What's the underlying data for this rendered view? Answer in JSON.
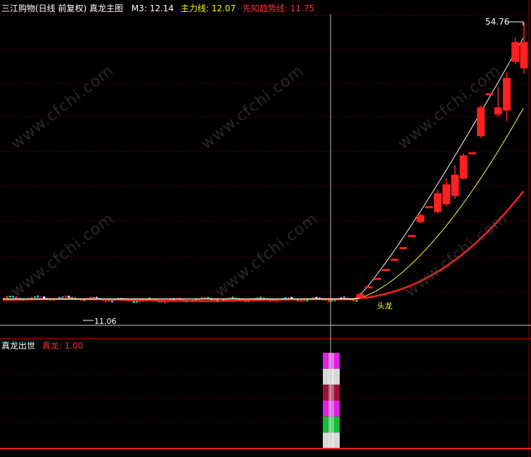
{
  "main_panel": {
    "title": "三江购物(日线 前复权) 真龙主图",
    "indicators": [
      {
        "label": "M3: ",
        "value": "12.14",
        "color": "#ffffff"
      },
      {
        "label": "主力线: ",
        "value": "12.07",
        "color": "#ffff00"
      },
      {
        "label": "先知趋势线: ",
        "value": "11.75",
        "color": "#ff3030"
      }
    ],
    "high_label": "54.76",
    "low_label": "11.06",
    "signal_label": "头龙"
  },
  "sub_panel": {
    "title": "真龙出世",
    "indicator_label": "真龙: ",
    "indicator_value": "1.00"
  },
  "watermark": "www.cfchi.com",
  "colors": {
    "background": "#000000",
    "grid": "#5a0000",
    "up": "#ff2020",
    "white_line": "#ffffff",
    "yellow_line": "#ffff40",
    "red_line": "#ff2020",
    "cursor": "#c0c0c0"
  },
  "chart_data": {
    "type": "candlestick",
    "y_range": [
      9,
      56
    ],
    "flat_period": {
      "bars": 115,
      "price": 11.5
    },
    "rally_candles": [
      {
        "open": 11.8,
        "close": 12.3,
        "high": 12.6,
        "low": 11.7
      },
      {
        "open": 13.5,
        "close": 13.5,
        "high": 13.5,
        "low": 13.5
      },
      {
        "open": 14.8,
        "close": 14.8,
        "high": 14.8,
        "low": 14.8
      },
      {
        "open": 16.2,
        "close": 16.2,
        "high": 16.2,
        "low": 16.2
      },
      {
        "open": 17.8,
        "close": 17.8,
        "high": 17.8,
        "low": 17.8
      },
      {
        "open": 19.6,
        "close": 19.6,
        "high": 19.6,
        "low": 19.6
      },
      {
        "open": 21.5,
        "close": 21.5,
        "high": 21.5,
        "low": 21.5
      },
      {
        "open": 23.6,
        "close": 24.6,
        "high": 24.9,
        "low": 23.4
      },
      {
        "open": 26.0,
        "close": 26.0,
        "high": 26.0,
        "low": 26.0
      },
      {
        "open": 25.2,
        "close": 28.0,
        "high": 28.6,
        "low": 24.9
      },
      {
        "open": 26.4,
        "close": 29.4,
        "high": 30.4,
        "low": 26.0
      },
      {
        "open": 27.7,
        "close": 30.9,
        "high": 32.4,
        "low": 27.2
      },
      {
        "open": 30.4,
        "close": 33.9,
        "high": 34.3,
        "low": 30.2
      },
      {
        "open": 34.4,
        "close": 34.4,
        "high": 34.4,
        "low": 34.4
      },
      {
        "open": 37.0,
        "close": 41.4,
        "high": 41.8,
        "low": 36.7
      },
      {
        "open": 43.6,
        "close": 43.6,
        "high": 43.6,
        "low": 43.6
      },
      {
        "open": 41.4,
        "close": 40.4,
        "high": 44.6,
        "low": 40.0
      },
      {
        "open": 41.0,
        "close": 46.0,
        "high": 46.9,
        "low": 39.3
      },
      {
        "open": 48.6,
        "close": 51.6,
        "high": 52.3,
        "low": 48.2
      },
      {
        "open": 51.6,
        "close": 47.6,
        "high": 54.76,
        "low": 46.7
      }
    ],
    "lines": [
      {
        "name": "M3",
        "last": 12.14
      },
      {
        "name": "主力线",
        "last": 12.07
      },
      {
        "name": "先知趋势线",
        "last": 11.75
      }
    ],
    "sub_indicator": {
      "name": "真龙",
      "value": 1.0,
      "bar_segments": [
        "magenta",
        "white",
        "maroon",
        "magenta",
        "green",
        "white"
      ]
    }
  }
}
